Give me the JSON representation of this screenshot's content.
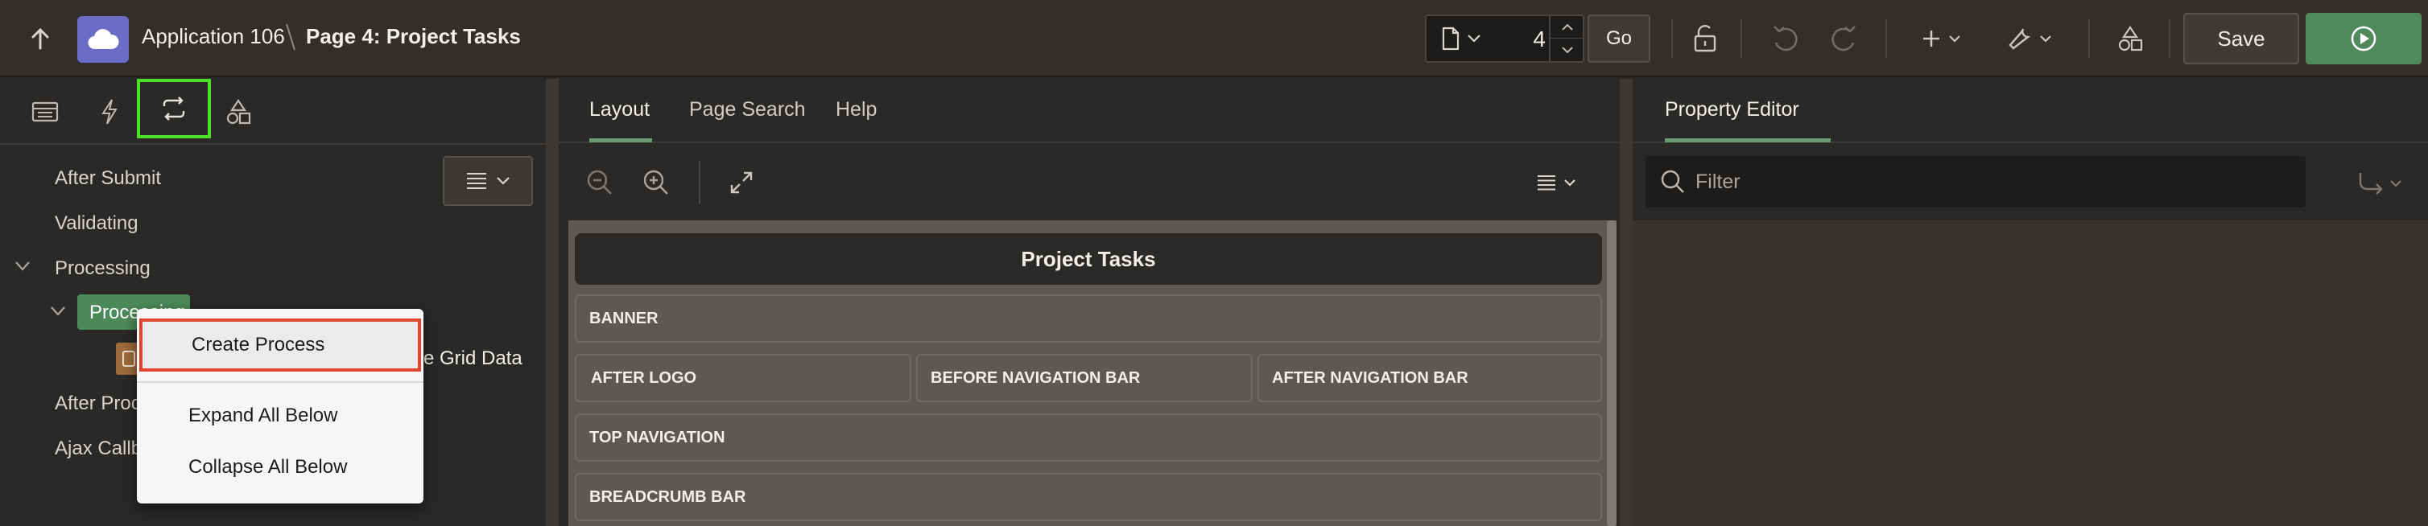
{
  "header": {
    "app_name": "Application 106",
    "breadcrumb_separator": "\\",
    "page_name": "Page 4: Project Tasks",
    "page_number": "4",
    "go_label": "Go",
    "save_label": "Save",
    "colors": {
      "app_icon_bg": "#6a6cc6",
      "run_bg": "#4f8a5c"
    },
    "icons": [
      "up-arrow-icon",
      "cloud-icon",
      "document-icon",
      "lock-icon",
      "undo-icon",
      "redo-icon",
      "plus-icon",
      "wrench-icon",
      "shapes-icon",
      "play-icon"
    ]
  },
  "left": {
    "tabs": [
      "rendering-tab",
      "dynamic-actions-tab",
      "processing-tab",
      "shared-components-tab"
    ],
    "active_tab": "processing-tab",
    "tree": {
      "after_submit": "After Submit",
      "validating": "Validating",
      "processing": "Processing",
      "process_selected": "Processing",
      "child_suffix": "e Grid Data",
      "after_processing": "After Proc",
      "ajax_callback": "Ajax Callb"
    },
    "context_menu": {
      "create_process": "Create Process",
      "expand_all": "Expand All Below",
      "collapse_all": "Collapse All Below"
    },
    "highlight_color": "#4be02c"
  },
  "center": {
    "tabs": {
      "layout": "Layout",
      "page_search": "Page Search",
      "help": "Help"
    },
    "page_title": "Project Tasks",
    "regions": {
      "banner": "BANNER",
      "after_logo": "AFTER LOGO",
      "before_nav": "BEFORE NAVIGATION BAR",
      "after_nav": "AFTER NAVIGATION BAR",
      "top_nav": "TOP NAVIGATION",
      "breadcrumb": "BREADCRUMB BAR"
    }
  },
  "right": {
    "tab": "Property Editor",
    "filter_placeholder": "Filter"
  }
}
